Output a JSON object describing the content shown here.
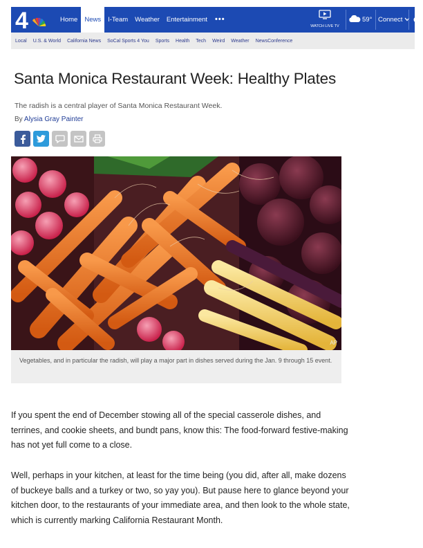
{
  "nav": {
    "logo_text": "4",
    "items": [
      {
        "label": "Home",
        "active": false
      },
      {
        "label": "News",
        "active": true
      },
      {
        "label": "I-Team",
        "active": false
      },
      {
        "label": "Weather",
        "active": false
      },
      {
        "label": "Entertainment",
        "active": false
      }
    ],
    "more_label": "•••",
    "watch_label": "WATCH LIVE TV",
    "temperature": "59°",
    "connect_label": "Connect",
    "icons": [
      "tv-icon",
      "cloud-icon",
      "chevron-down-icon",
      "search-icon"
    ],
    "bar_color": "#1c4ab3"
  },
  "subnav": {
    "items": [
      "Local",
      "U.S. & World",
      "California News",
      "SoCal Sports 4 You",
      "Sports",
      "Health",
      "Tech",
      "Weird",
      "Weather",
      "NewsConference"
    ]
  },
  "article": {
    "headline": "Santa Monica Restaurant Week: Healthy Plates",
    "subhead": "The radish is a central player of Santa Monica Restaurant Week.",
    "byline_prefix": "By",
    "author": "Alysia Gray Painter",
    "share_icons": [
      "facebook-icon",
      "twitter-icon",
      "comment-icon",
      "email-icon",
      "print-icon"
    ],
    "photo_credit": "AP",
    "caption": "Vegetables, and in particular the radish, will play a major part in dishes served during the Jan. 9 through 15 event.",
    "paragraphs": [
      "If you spent the end of December stowing all of the special casserole dishes, and terrines, and cookie sheets, and bundt pans, know this: The food-forward festive-making has not yet full come to a close.",
      "Well, perhaps in your kitchen, at least for the time being (you did, after all, make dozens of buckeye balls and a turkey or two, so yay you). But pause here to glance beyond your kitchen door, to the restaurants of your immediate area, and then look to the whole state, which is currently marking California Restaurant Month."
    ]
  }
}
